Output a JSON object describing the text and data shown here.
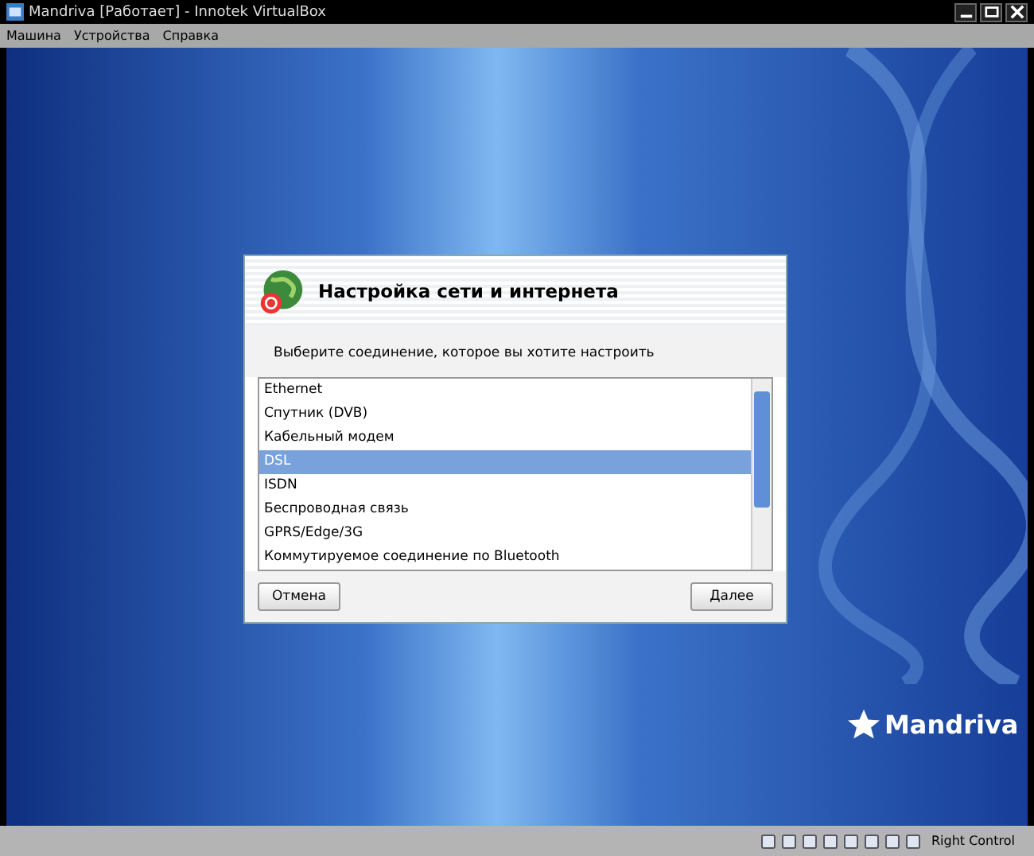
{
  "window": {
    "title": "Mandriva [Работает] - Innotek VirtualBox"
  },
  "menu": [
    "Машина",
    "Устройства",
    "Справка"
  ],
  "dialog": {
    "title": "Настройка сети и интернета",
    "prompt": "Выберите соединение, которое вы хотите настроить",
    "items": [
      {
        "label": "Ethernet",
        "selected": false
      },
      {
        "label": "Спутник (DVB)",
        "selected": false
      },
      {
        "label": "Кабельный модем",
        "selected": false
      },
      {
        "label": "DSL",
        "selected": true
      },
      {
        "label": "ISDN",
        "selected": false
      },
      {
        "label": "Беспроводная связь",
        "selected": false
      },
      {
        "label": "GPRS/Edge/3G",
        "selected": false
      },
      {
        "label": "Коммутируемое соединение по Bluetooth",
        "selected": false
      }
    ],
    "buttons": [
      "Отмена",
      "Далее"
    ]
  },
  "logo": "Mandriva",
  "status_bar": {
    "host_key": "Right Control"
  }
}
